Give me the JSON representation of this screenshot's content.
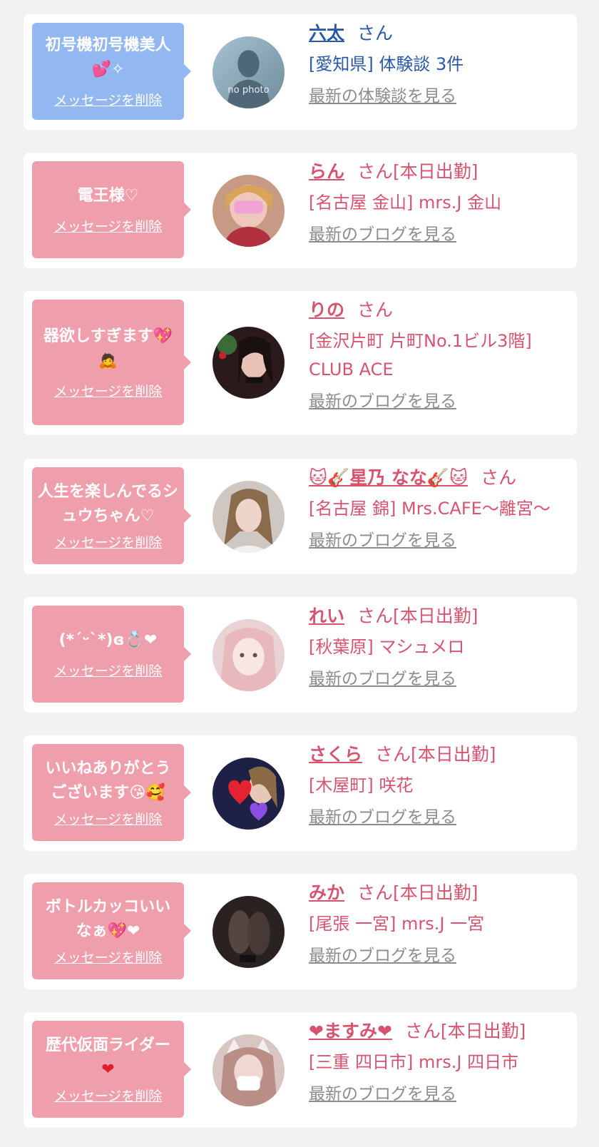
{
  "cards": [
    {
      "bubble_msg": "初号機初号機美人",
      "bubble_emoji": "💕✧",
      "delete_label": "メッセージを削除",
      "name": "六太",
      "san": "さん",
      "shop": "[愛知県] 体験談 3件",
      "latest": "最新の体験談を見る",
      "style": "blue"
    },
    {
      "bubble_msg": "電王様♡",
      "delete_label": "メッセージを削除",
      "name": "らん",
      "san": "さん[本日出勤]",
      "shop": "[名古屋 金山] mrs.J 金山",
      "latest": "最新のブログを見る",
      "style": "pink"
    },
    {
      "bubble_msg": "器欲しすぎます💖",
      "bubble_emoji": "🙇",
      "delete_label": "メッセージを削除",
      "name": "りの",
      "san": "さん",
      "shop": "[金沢片町 片町No.1ビル3階] CLUB ACE",
      "latest": "最新のブログを見る",
      "style": "pink"
    },
    {
      "bubble_msg": "人生を楽しんでるシュウちゃん♡",
      "delete_label": "メッセージを削除",
      "name": "🐱🎸星乃 なな🎸🐱",
      "san": "さん",
      "shop": "[名古屋 錦] Mrs.CAFE〜離宮〜",
      "latest": "最新のブログを見る",
      "style": "pink"
    },
    {
      "bubble_msg": "(*´ᵕ`*)ɞ💍❤",
      "delete_label": "メッセージを削除",
      "name": "れい",
      "san": "さん[本日出勤]",
      "shop": "[秋葉原] マシュメロ",
      "latest": "最新のブログを見る",
      "style": "pink"
    },
    {
      "bubble_msg": "いいねありがとうございます😘🥰",
      "delete_label": "メッセージを削除",
      "name": "さくら",
      "san": "さん[本日出勤]",
      "shop": "[木屋町] 咲花",
      "latest": "最新のブログを見る",
      "style": "pink"
    },
    {
      "bubble_msg": "ボトルカッコいいなぁ💖❤",
      "delete_label": "メッセージを削除",
      "name": "みか",
      "san": "さん[本日出勤]",
      "shop": "[尾張 一宮] mrs.J 一宮",
      "latest": "最新のブログを見る",
      "style": "pink"
    },
    {
      "bubble_msg": "歴代仮面ライダー",
      "bubble_emoji": "❤",
      "delete_label": "メッセージを削除",
      "name": "❤ますみ❤",
      "san": "さん[本日出勤]",
      "shop": "[三重 四日市] mrs.J 四日市",
      "latest": "最新のブログを見る",
      "style": "pink"
    }
  ],
  "no_photo_label": "no photo",
  "colors": {
    "page_bg": "#f2f2f2",
    "pink_bubble": "#ef9fac",
    "blue_bubble": "#93b8f1",
    "pink_text": "#d6546e",
    "blue_text": "#2a59a8",
    "link_gray": "#8c8c8c"
  }
}
